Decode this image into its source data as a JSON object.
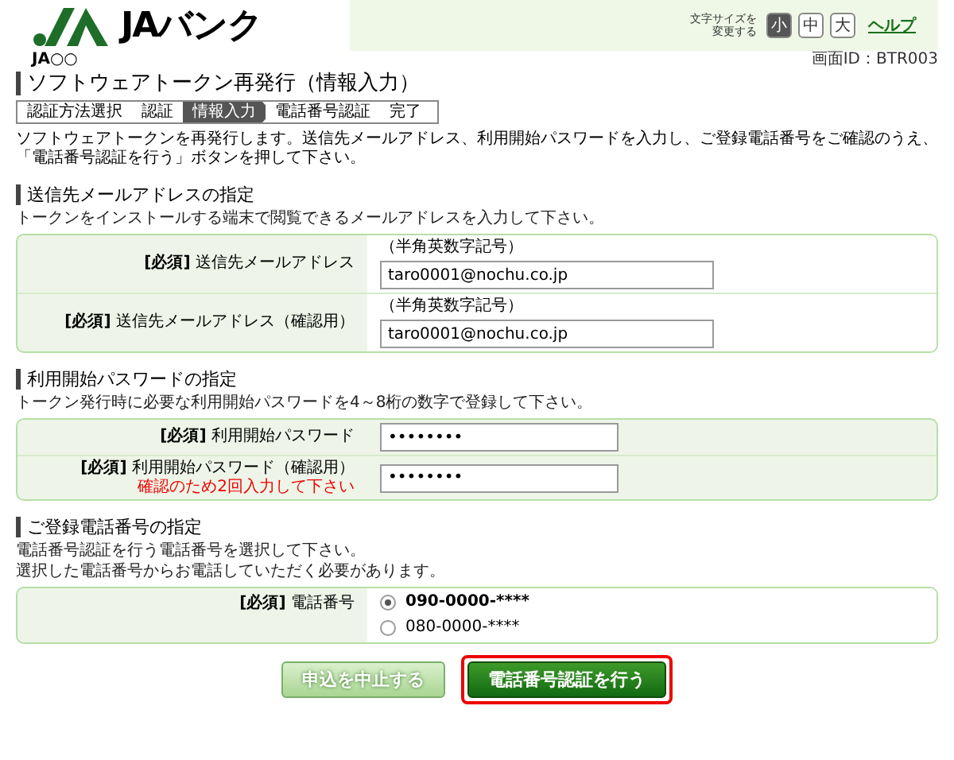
{
  "header": {
    "brand": "JAバンク",
    "branch": "JA○○",
    "font_size_label": [
      "文字サイズを",
      "変更する"
    ],
    "font_sizes": [
      {
        "label": "小",
        "selected": true
      },
      {
        "label": "中",
        "selected": false
      },
      {
        "label": "大",
        "selected": false
      }
    ],
    "help": "ヘルプ"
  },
  "screen_id": "画面ID：BTR003",
  "title": "ソフトウェアトークン再発行（情報入力）",
  "steps": [
    {
      "label": "認証方法選択",
      "selected": false
    },
    {
      "label": "認証",
      "selected": false
    },
    {
      "label": "情報入力",
      "selected": true
    },
    {
      "label": "電話番号認証",
      "selected": false
    },
    {
      "label": "完了",
      "selected": false
    }
  ],
  "intro": "ソフトウェアトークンを再発行します。送信先メールアドレス、利用開始パスワードを入力し、ご登録電話番号をご確認のうえ、「電話番号認証を行う」ボタンを押して下さい。",
  "sections": [
    {
      "title": "送信先メールアドレスの指定",
      "description": [
        "トークンをインストールする端末で閲覧できるメールアドレスを入力して下さい。"
      ],
      "fields": [
        {
          "kind": "text",
          "required": "[必須]",
          "label": "送信先メールアドレス",
          "hint": "（半角英数字記号）",
          "value": "taro0001@nochu.co.jp"
        },
        {
          "kind": "text",
          "required": "[必須]",
          "label": "送信先メールアドレス（確認用）",
          "hint": "（半角英数字記号）",
          "value": "taro0001@nochu.co.jp"
        }
      ]
    },
    {
      "title": "利用開始パスワードの指定",
      "description": [
        "トークン発行時に必要な利用開始パスワードを4～8桁の数字で登録して下さい。"
      ],
      "fields": [
        {
          "kind": "password",
          "required": "[必須]",
          "label": "利用開始パスワード",
          "value": "••••••••"
        },
        {
          "kind": "password",
          "required": "[必須]",
          "label": "利用開始パスワード（確認用）",
          "note": "確認のため2回入力して下さい",
          "value": "••••••••"
        }
      ]
    },
    {
      "title": "ご登録電話番号の指定",
      "description": [
        "電話番号認証を行う電話番号を選択して下さい。",
        "選択した電話番号からお電話していただく必要があります。"
      ],
      "fields": [
        {
          "kind": "radio",
          "required": "[必須]",
          "label": "電話番号",
          "options": [
            {
              "label": "090-0000-****",
              "selected": true
            },
            {
              "label": "080-0000-****",
              "selected": false
            }
          ]
        }
      ]
    }
  ],
  "buttons": [
    {
      "label": "申込を中止する",
      "kind": "secondary",
      "highlighted": false
    },
    {
      "label": "電話番号認証を行う",
      "kind": "primary",
      "highlighted": true
    }
  ]
}
